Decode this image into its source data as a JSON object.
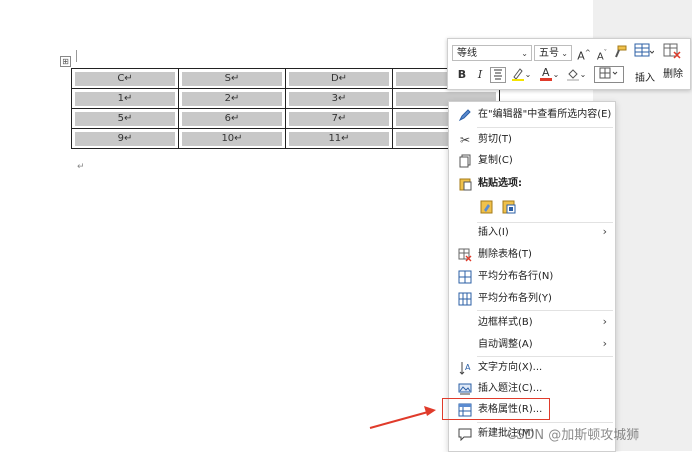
{
  "table": {
    "rows": [
      [
        "C↵",
        "S↵",
        "D↵",
        ""
      ],
      [
        "1↵",
        "2↵",
        "3↵",
        ""
      ],
      [
        "5↵",
        "6↵",
        "7↵",
        ""
      ],
      [
        "9↵",
        "10↵",
        "11↵",
        ""
      ]
    ],
    "paragraph_mark": "↵",
    "move_handle": "⊞"
  },
  "mini_toolbar": {
    "font_name": "等线",
    "font_size": "五号",
    "bold": "B",
    "italic": "I",
    "insert_label": "插入",
    "delete_label": "删除"
  },
  "context_menu": {
    "items": [
      {
        "label": "在\"编辑器\"中查看所选内容(E)",
        "icon": "pen-icon"
      },
      {
        "label": "剪切(T)",
        "icon": "scissors-icon"
      },
      {
        "label": "复制(C)",
        "icon": "copy-icon"
      },
      {
        "label": "粘贴选项:",
        "icon": "clipboard-icon"
      },
      {
        "label": "插入(I)",
        "icon": ""
      },
      {
        "label": "删除表格(T)",
        "icon": "delete-table-icon"
      },
      {
        "label": "平均分布各行(N)",
        "icon": "distribute-rows-icon"
      },
      {
        "label": "平均分布各列(Y)",
        "icon": "distribute-columns-icon"
      },
      {
        "label": "边框样式(B)",
        "icon": ""
      },
      {
        "label": "自动调整(A)",
        "icon": ""
      },
      {
        "label": "文字方向(X)...",
        "icon": "text-direction-icon"
      },
      {
        "label": "插入题注(C)...",
        "icon": "caption-icon"
      },
      {
        "label": "表格属性(R)...",
        "icon": "table-properties-icon"
      },
      {
        "label": "新建批注(M)",
        "icon": "comment-icon"
      }
    ]
  },
  "watermark": "CSDN @加斯顿攻城狮",
  "colors": {
    "highlight_box": "#e03b2b",
    "arrow": "#e03b2b",
    "font_color": "#e03b2b",
    "highlight_yellow": "#f5e400"
  }
}
